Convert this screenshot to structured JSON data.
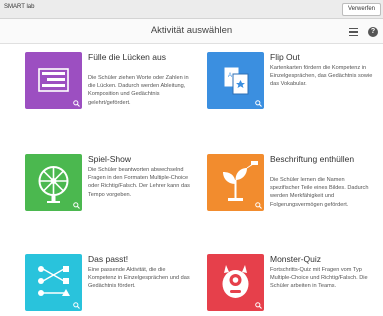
{
  "app": {
    "name": "SMART lab",
    "discard_label": "Verwerfen"
  },
  "header": {
    "title": "Aktivität auswählen",
    "menu_icon": "hamburger-menu-icon",
    "help_icon": "help-icon",
    "help_glyph": "?"
  },
  "activities": [
    {
      "title": "Fülle die Lücken aus",
      "description": "Die Schüler ziehen Worte oder Zahlen in die Lücken. Dadurch werden Ableitung, Komposition und Gedächtnis gelehrt/gefördert.",
      "color": "#9c4fc1",
      "icon": "fill-blanks-icon"
    },
    {
      "title": "Flip Out",
      "description": "Kartenkarten fördern die Kompetenz in Einzelgesprächen, das Gedächtnis sowie das Vokabular.",
      "color": "#3b8fe0",
      "icon": "flashcards-icon"
    },
    {
      "title": "Spiel-Show",
      "description": "Die Schüler beantworten abwechselnd Fragen in den Formaten Multiple-Choice oder Richtig/Falsch. Der Lehrer kann das Tempo vorgeben.",
      "color": "#4bb84f",
      "icon": "game-wheel-icon"
    },
    {
      "title": "Beschriftung enthüllen",
      "description": "Die Schüler lernen die Namen spezifischer Teile eines Bildes. Dadurch werden Merkfähigkeit und Folgerungsvermögen gefördert.",
      "color": "#f28c2e",
      "icon": "labelled-plant-icon"
    },
    {
      "title": "Das passt!",
      "description": "Eine passende Aktivität, die die Kompetenz in Einzelgesprächen und das Gedächtnis fördert.",
      "color": "#29c3dc",
      "icon": "matching-icon"
    },
    {
      "title": "Monster-Quiz",
      "description": "Fortschritts-Quiz mit Fragen vom Typ Multiple-Choice und Richtig/Falsch. Die Schüler arbeiten in Teams.",
      "color": "#e6404b",
      "icon": "monster-icon"
    }
  ]
}
